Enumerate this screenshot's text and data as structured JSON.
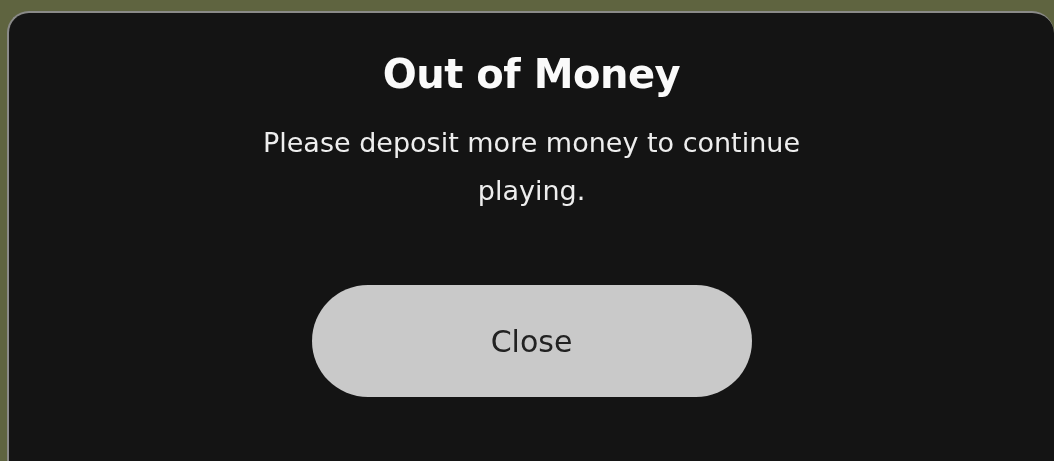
{
  "dialog": {
    "title": "Out of Money",
    "message": "Please deposit more money to continue playing.",
    "buttons": [
      "Close"
    ]
  }
}
